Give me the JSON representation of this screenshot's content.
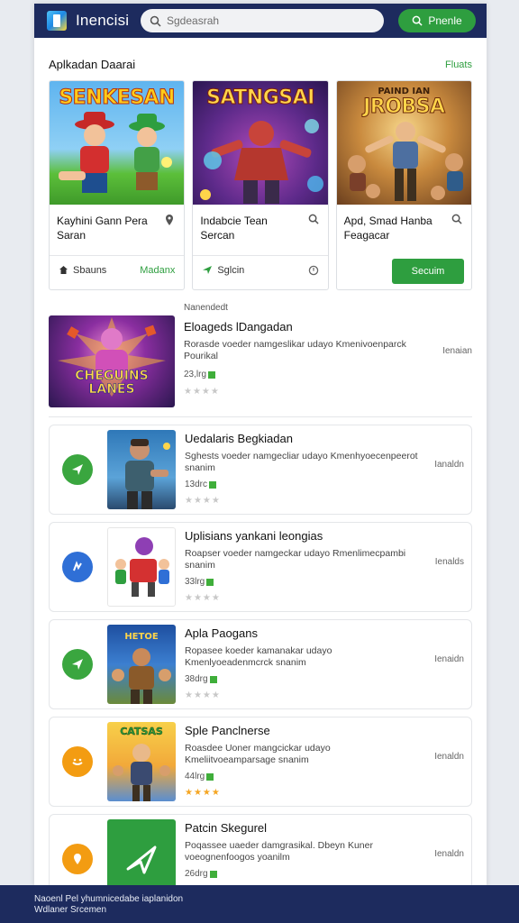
{
  "header": {
    "app_title": "Inencisi",
    "search_placeholder": "Sgdeasrah",
    "button_label": "Pnenle"
  },
  "section": {
    "title": "Aplkadan Daarai",
    "link": "Fluats"
  },
  "featured": [
    {
      "banner": "SENKESAN",
      "name": "Kayhini Gann Pera Saran",
      "icon": "map-pin-icon",
      "foot_left": "Sbauns",
      "foot_right": "Madanx"
    },
    {
      "banner": "SATNGSAI",
      "name": "Indabcie Tean Sercan",
      "icon": "search-icon",
      "foot_left": "Sglcin",
      "foot_right": ""
    },
    {
      "banner": "JROBSA",
      "banner_top": "PAIND IAN",
      "name": "Apd, Smad Hanba Feagacar",
      "icon": "search-icon",
      "button": "Secuim"
    }
  ],
  "list": {
    "first": {
      "kicker": "Nanendedt",
      "art_title": "CHEGUINS LANES",
      "title": "Eloageds lDangadan",
      "desc": "Rorasde voeder namgeslikar udayo Kmenivoenparck Pourikal",
      "size": "23,lrg",
      "stars": "★★★★",
      "action": "Ienaian"
    },
    "items": [
      {
        "title": "Uedalaris Begkiadan",
        "desc": "Sghests voeder namgecliar udayo Kmenhyoecenpeerot snanim",
        "size": "13drc",
        "stars": "★★★★",
        "action": "Ianaldn",
        "circle_color": "#3aa63f",
        "icon": "send-icon"
      },
      {
        "title": "Uplisians yankani leongias",
        "desc": "Roapser voeder namgeckar udayo Rmenlimecpambi snanim",
        "size": "33lrg",
        "stars": "★★★★",
        "action": "Ienalds",
        "circle_color": "#2f6fd6",
        "icon": "compass-icon"
      },
      {
        "title": "Apla Paogans",
        "desc": "Ropasee koeder kamanakar udayo Kmenlyoeadenmcrck snanim",
        "size": "38drg",
        "stars": "★★★★",
        "action": "Ienaidn",
        "circle_color": "#3aa63f",
        "icon": "send-icon"
      },
      {
        "title": "Sple Panclnerse",
        "desc": "Roasdee Uoner mangcickar udayo Kmeliitvoeamparsage snanim",
        "size": "44lrg",
        "stars": "★★★★",
        "action": "Ienaldn",
        "circle_color": "#f39c12",
        "icon": "controller-icon",
        "gold": true,
        "art_title": "CATSAS"
      },
      {
        "title": "Patcin Skegurel",
        "desc": "Poqassee uaeder damgrasikal. Dbeyn Kuner voeognenfoogos yoanilm",
        "size": "26drg",
        "stars": "★★★★",
        "action": "Ienaldn",
        "circle_color": "#f39c12",
        "icon": "pin-icon"
      }
    ]
  },
  "footer": {
    "line1": "Naoenl Pel yhumnicedabe iaplanidon",
    "line2": "Wdlaner Srcemen"
  }
}
